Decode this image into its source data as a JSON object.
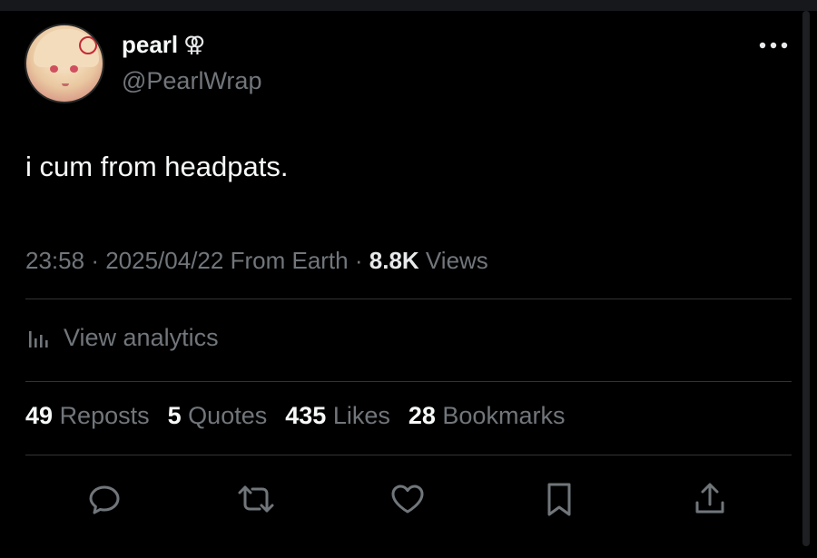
{
  "user": {
    "display_name": "pearl",
    "name_symbol": "⚢",
    "handle": "@PearlWrap"
  },
  "tweet": {
    "text": "i cum from headpats."
  },
  "meta": {
    "time": "23:58",
    "separator": "·",
    "date": "2025/04/22",
    "location": "From Earth",
    "views_count": "8.8K",
    "views_label": "Views"
  },
  "analytics": {
    "label": "View analytics"
  },
  "stats": [
    {
      "count": "49",
      "label": "Reposts"
    },
    {
      "count": "5",
      "label": "Quotes"
    },
    {
      "count": "435",
      "label": "Likes"
    },
    {
      "count": "28",
      "label": "Bookmarks"
    }
  ],
  "actions": {
    "icons": [
      "reply-icon",
      "repost-icon",
      "like-icon",
      "bookmark-icon",
      "share-icon"
    ]
  },
  "colors": {
    "background": "#000000",
    "primary_text": "#e7e9ea",
    "secondary_text": "#71767b",
    "divider": "#2f3336"
  }
}
